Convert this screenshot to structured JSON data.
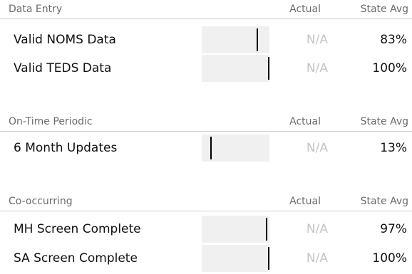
{
  "sections": [
    {
      "title": "Data Entry",
      "actual_header": "Actual",
      "avg_header": "State Avg",
      "rows": [
        {
          "label": "Valid NOMS Data",
          "actual": "N/A",
          "state_avg": "83%",
          "marker_fraction": 0.83
        },
        {
          "label": "Valid TEDS Data",
          "actual": "N/A",
          "state_avg": "100%",
          "marker_fraction": 1.0
        }
      ]
    },
    {
      "title": "On-Time Periodic",
      "actual_header": "Actual",
      "avg_header": "State Avg",
      "rows": [
        {
          "label": "6 Month Updates",
          "actual": "N/A",
          "state_avg": "13%",
          "marker_fraction": 0.13
        }
      ]
    },
    {
      "title": "Co-occurring",
      "actual_header": "Actual",
      "avg_header": "State Avg",
      "rows": [
        {
          "label": "MH Screen Complete",
          "actual": "N/A",
          "state_avg": "97%",
          "marker_fraction": 0.97
        },
        {
          "label": "SA Screen Complete",
          "actual": "N/A",
          "state_avg": "100%",
          "marker_fraction": 1.0
        }
      ]
    }
  ]
}
